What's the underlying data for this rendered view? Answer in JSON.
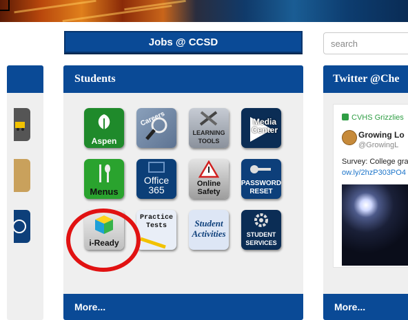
{
  "header": {
    "jobs_label": "Jobs @ CCSD",
    "search_placeholder": "search"
  },
  "students_panel": {
    "title": "Students",
    "more_label": "More...",
    "tiles": [
      {
        "label": "Aspen",
        "icon": "aspen-leaf-icon",
        "color": "#1f8a2b"
      },
      {
        "label": "Careers",
        "icon": "magnifier-icon",
        "color": "#7a8fa8"
      },
      {
        "label": "LEARNING TOOLS",
        "icon": "tools-icon",
        "color": "#9aa0aa"
      },
      {
        "label": "Media Center",
        "icon": "play-icon",
        "color": "#0b2d55"
      },
      {
        "label": "Menus",
        "icon": "fork-spoon-icon",
        "color": "#2aa32e"
      },
      {
        "label": "Office 365",
        "icon": "office-icon",
        "color": "#0c3f78"
      },
      {
        "label": "Online Safety",
        "icon": "warning-icon",
        "color": "#b8b8b8"
      },
      {
        "label": "PASSWORD RESET",
        "icon": "key-icon",
        "color": "#0d3f7a"
      },
      {
        "label": "i-Ready",
        "icon": "cube-icon",
        "color": "#d9d9d9"
      },
      {
        "label": "Practice Tests",
        "icon": "pencil-icon",
        "color": "#e9eef7"
      },
      {
        "label": "Student Activities",
        "icon": "none",
        "color": "#dde6f5"
      },
      {
        "label": "STUDENT SERVICES",
        "icon": "gear-icon",
        "color": "#0b2d55"
      }
    ]
  },
  "twitter_panel": {
    "title": "Twitter @Che",
    "more_label": "More...",
    "tweet": {
      "retweeted_by": "CVHS Grizzlies",
      "user": "Growing Lo",
      "handle": "@GrowingL",
      "text": "Survey: College gra",
      "link": "ow.ly/2hzP303PO4"
    }
  },
  "left_panel": {
    "tile_colors": [
      "#555555",
      "#c9a15c",
      "#0d3f7a"
    ]
  },
  "highlight": {
    "color": "#e11212"
  }
}
